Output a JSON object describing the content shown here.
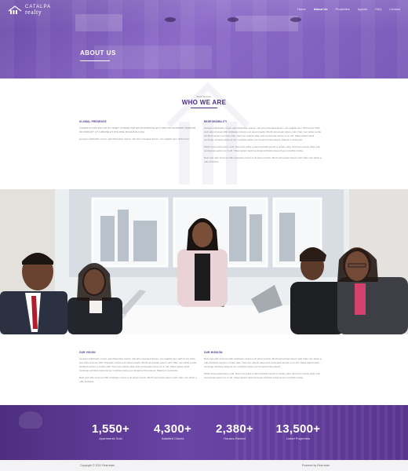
{
  "brand": {
    "line1": "CATALPA",
    "line2": "realty"
  },
  "nav": {
    "items": [
      {
        "label": "Home"
      },
      {
        "label": "About Us",
        "active": true
      },
      {
        "label": "Properties"
      },
      {
        "label": "Agents"
      },
      {
        "label": "FAQ"
      },
      {
        "label": "Contact"
      }
    ]
  },
  "hero": {
    "title": "ABOUT US"
  },
  "who": {
    "kicker": "Real Estate",
    "title": "WHO WE ARE"
  },
  "global_presence": {
    "heading": "GLOBAL PRESENCE",
    "p1": "LOREM IPSUM DOLOR SIT AMET CONSECTETUR ADIPISCING ELIT SED DO EIUSMOD TEMPOR INCIDIDUNT UT LABORE ET DOLORE MAGNA ALIQUA",
    "p2": "Aenean sollicitudin, lorem quis bibendum auctor, nisi elit consequat ipsum, nec sagittis sem nibh id elit."
  },
  "responsibility": {
    "heading": "RESPONSIBILITY",
    "p1": "Aenean sollicitudin, lorem quis bibendum auctor, nisi elit consequat ipsum, nec sagittis sem nibh id elit. Duis sed odio sit amet nibh vulputate cursus a sit amet mauris. Morbi accumsan ipsum velit. Nam nec tellus a odio tincidunt auctor a ornare odio. Sed non mauris vitae erat consequat auctor eu in elit. Class aptent taciti sociosqu ad litora torquent per conubia nostra, per inceptos himenaeos. Mauris in erat justo.",
    "p2": "Morbi accumsan ipsum velit. Nam nec tellus a odio tincidunt auctor a ornare odio. Sed non mauris vitae erat consequat auctor eu in elit. Class aptent taciti sociosqu ad litora torquent per conubia nostra.",
    "p3": "Duis sed odio sit amet nibh vulputate cursus a sit amet mauris. Morbi accumsan ipsum velit. Nam nec tellus a odio tincidunt."
  },
  "overview": {
    "heading": "OUR VISION",
    "p1": "Aenean sollicitudin, lorem quis bibendum auctor, nisi elit consequat ipsum, nec sagittis sem nibh id elit. Duis sed odio sit amet nibh vulputate cursus a sit amet mauris. Morbi accumsan ipsum velit. Nam nec tellus a odio tincidunt auctor a ornare odio. Sed non mauris vitae erat consequat auctor eu in elit. Class aptent taciti sociosqu ad litora torquent per conubia nostra, per inceptos himenaeos. Mauris in erat justo.",
    "p2": "Duis sed odio sit amet nibh vulputate cursus a sit amet mauris. Morbi accumsan ipsum velit. Nam nec tellus a odio tincidunt."
  },
  "mission": {
    "heading": "OUR MISSION",
    "p1": "Duis sed odio sit amet nibh vulputate cursus a sit amet mauris. Morbi accumsan ipsum velit. Nam nec tellus a odio tincidunt auctor a ornare odio. Sed non mauris vitae erat consequat auctor eu in elit. Class aptent taciti sociosqu ad litora torquent per conubia nostra, per inceptos himenaeos.",
    "p2": "Morbi accumsan ipsum velit. Nam nec tellus a odio tincidunt auctor a ornare odio. Sed non mauris vitae erat consequat auctor eu in elit. Class aptent taciti sociosqu ad litora torquent per conubia nostra."
  },
  "stats": [
    {
      "num": "1,550+",
      "label": "Apartments Sold"
    },
    {
      "num": "4,300+",
      "label": "Satisfied Clients"
    },
    {
      "num": "2,380+",
      "label": "Houses Rented"
    },
    {
      "num": "13,500+",
      "label": "Listed Properties"
    }
  ],
  "footer": {
    "copyright": "Copyright © 2021 Real state",
    "powered": "Powered by Real state"
  },
  "colors": {
    "accent": "#4a2f86",
    "hero": "#7a5bb9",
    "stats": "#5a368f"
  },
  "icons": {
    "logo": "house-roof-logo-icon"
  }
}
